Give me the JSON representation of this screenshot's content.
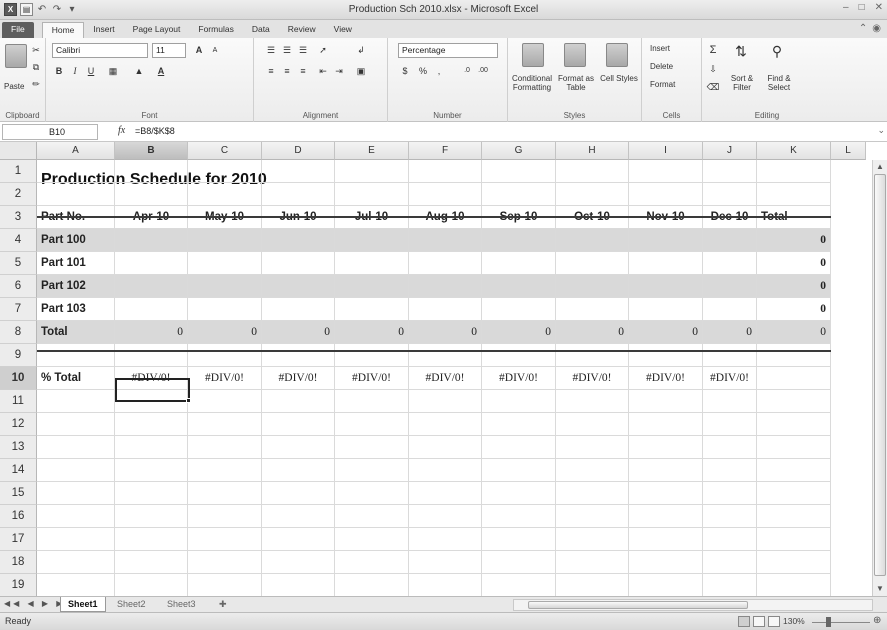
{
  "window": {
    "title": "Production Sch 2010.xlsx - Microsoft Excel",
    "controls": [
      "–",
      "□",
      "✕"
    ]
  },
  "ribbon_tabs": [
    "File",
    "Home",
    "Insert",
    "Page Layout",
    "Formulas",
    "Data",
    "Review",
    "View"
  ],
  "ribbon": {
    "clipboard": {
      "paste": "Paste",
      "label": "Clipboard"
    },
    "font": {
      "name": "Calibri",
      "size": "11",
      "label": "Font",
      "bold": "B",
      "italic": "I",
      "underline": "U"
    },
    "alignment": {
      "label": "Alignment"
    },
    "number": {
      "format": "Percentage",
      "label": "Number",
      "currency": "$",
      "percent": "%",
      "comma": ","
    },
    "styles": {
      "conditional": "Conditional Formatting",
      "format_table": "Format as Table",
      "cell_styles": "Cell Styles",
      "label": "Styles"
    },
    "cells": {
      "insert": "Insert",
      "delete": "Delete",
      "format": "Format",
      "label": "Cells"
    },
    "editing": {
      "sort": "Sort & Filter",
      "find": "Find & Select",
      "label": "Editing",
      "sigma": "Σ"
    }
  },
  "formula_bar": {
    "name_box": "B10",
    "fx": "fx",
    "formula": "=B8/$K$8"
  },
  "columns": [
    "A",
    "B",
    "C",
    "D",
    "E",
    "F",
    "G",
    "H",
    "I",
    "J",
    "K",
    "L"
  ],
  "selected_column": "B",
  "selected_row": "10",
  "rows": [
    "1",
    "2",
    "3",
    "4",
    "5",
    "6",
    "7",
    "8",
    "9",
    "10",
    "11",
    "12",
    "13",
    "14",
    "15",
    "16",
    "17",
    "18",
    "19"
  ],
  "sheet": {
    "title": "Production Schedule for 2010",
    "header_row": [
      "Part No.",
      "Apr-10",
      "May-10",
      "Jun-10",
      "Jul-10",
      "Aug-10",
      "Sep-10",
      "Oct-10",
      "Nov-10",
      "Dec-10",
      "Total"
    ],
    "parts": [
      {
        "name": "Part 100",
        "total": "0"
      },
      {
        "name": "Part 101",
        "total": "0"
      },
      {
        "name": "Part 102",
        "total": "0"
      },
      {
        "name": "Part 103",
        "total": "0"
      }
    ],
    "total_row": {
      "label": "Total",
      "values": [
        "0",
        "0",
        "0",
        "0",
        "0",
        "0",
        "0",
        "0",
        "0",
        "0"
      ]
    },
    "pct_row": {
      "label": "% Total",
      "values": [
        "#DIV/0!",
        "#DIV/0!",
        "#DIV/0!",
        "#DIV/0!",
        "#DIV/0!",
        "#DIV/0!",
        "#DIV/0!",
        "#DIV/0!",
        "#DIV/0!"
      ]
    }
  },
  "sheet_tabs": [
    "Sheet1",
    "Sheet2",
    "Sheet3"
  ],
  "active_sheet": "Sheet1",
  "status": {
    "ready": "Ready",
    "zoom": "130%"
  }
}
